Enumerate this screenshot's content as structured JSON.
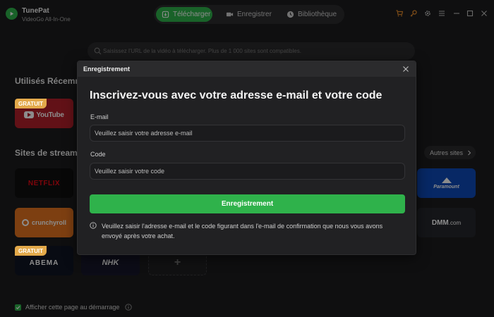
{
  "app": {
    "name": "TunePat",
    "subtitle": "VideoGo All-In-One"
  },
  "tabs": [
    {
      "label": "Télécharger",
      "active": true
    },
    {
      "label": "Enregistrer",
      "active": false
    },
    {
      "label": "Bibliothèque",
      "active": false
    }
  ],
  "search": {
    "placeholder": "Saisissez l'URL de la vidéo à télécharger. Plus de 1 000 sites sont compatibles."
  },
  "sections": {
    "recent": "Utilisés Récemm",
    "streaming": "Sites de stream"
  },
  "more_sites": "Autres sites",
  "badge": "GRATUIT",
  "sites": {
    "youtube": "YouTube",
    "netflix": "NETFLIX",
    "crunchyroll": "crunchyroll",
    "abema": "ABEMA",
    "nhk": "NHK",
    "add": "+",
    "paramount": "Paramount",
    "dmm": "DMM",
    "dmm_suffix": ".com"
  },
  "startup": {
    "label": "Afficher cette page au démarrage",
    "checked": true
  },
  "modal": {
    "title": "Enregistrement",
    "heading": "Inscrivez-vous avec votre adresse e-mail et votre code",
    "email_label": "E-mail",
    "email_placeholder": "Veuillez saisir votre adresse e-mail",
    "code_label": "Code",
    "code_placeholder": "Veuillez saisir votre code",
    "submit": "Enregistrement",
    "note": "Veuillez saisir l'adresse e-mail et le code figurant dans l'e-mail de confirmation que nous vous avons envoyé après votre achat."
  },
  "colors": {
    "accent": "#2fb24b",
    "background": "#1c1c1e",
    "modal": "#212123",
    "badge": "#e3a94a",
    "cart": "#e0892b",
    "key": "#e0892b"
  },
  "icons": [
    "logo-icon",
    "download-icon",
    "record-icon",
    "library-icon",
    "cart-icon",
    "key-icon",
    "settings-icon",
    "menu-icon",
    "minimize-icon",
    "maximize-icon",
    "close-icon",
    "search-icon",
    "info-icon",
    "check-icon",
    "chevron-right-icon"
  ]
}
